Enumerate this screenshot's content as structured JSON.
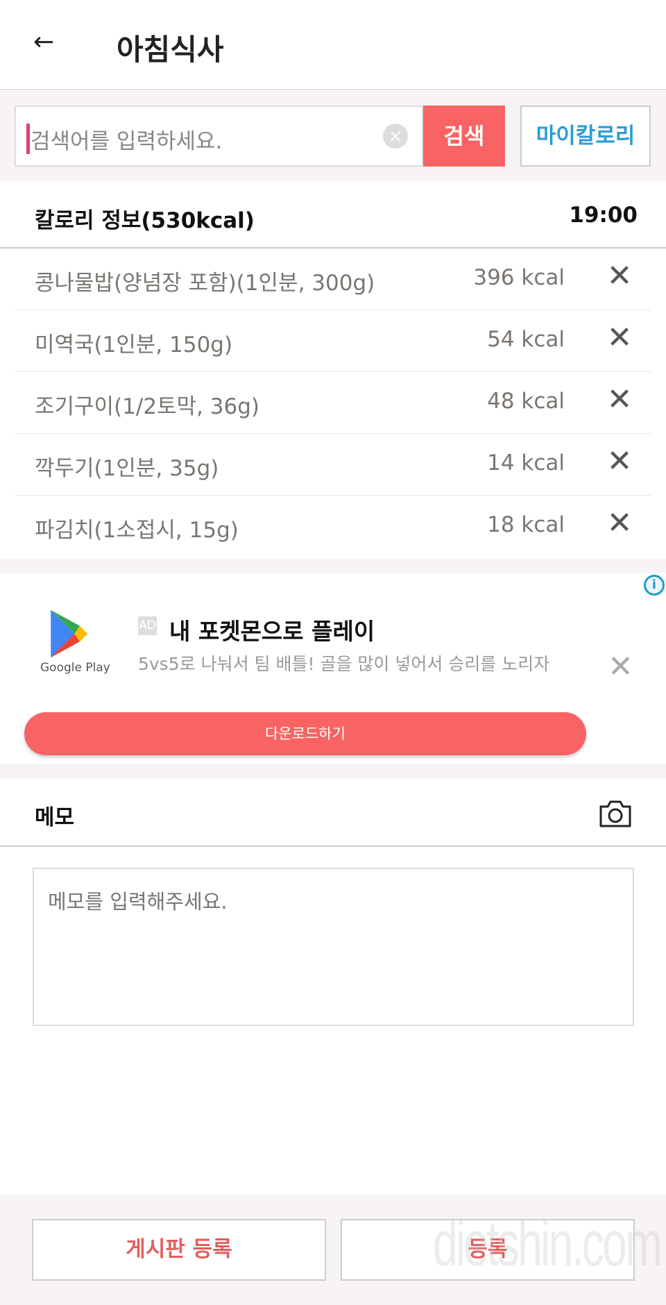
{
  "header": {
    "back_icon": "arrow-left-icon",
    "title": "아침식사"
  },
  "search": {
    "placeholder": "검색어를 입력하세요.",
    "clear_icon": "clear-circle-icon",
    "button": "검색",
    "my_calorie": "마이칼로리"
  },
  "calorie": {
    "title": "칼로리 정보(530kcal)",
    "time": "19:00",
    "items": [
      {
        "name": "콩나물밥(양념장 포함)(1인분, 300g)",
        "kcal": "396 kcal"
      },
      {
        "name": "미역국(1인분, 150g)",
        "kcal": "54 kcal"
      },
      {
        "name": "조기구이(1/2토막, 36g)",
        "kcal": "48 kcal"
      },
      {
        "name": "깍두기(1인분, 35g)",
        "kcal": "14 kcal"
      },
      {
        "name": "파김치(1소접시, 15g)",
        "kcal": "18 kcal"
      }
    ]
  },
  "ad": {
    "info": "i",
    "brand": "Google Play",
    "badge": "AD",
    "title": "내 포켓몬으로 플레이",
    "desc": "5vs5로 나눠서 팀 배틀! 골을 많이 넣어서 승리를 노리자",
    "download": "다운로드하기"
  },
  "memo": {
    "title": "메모",
    "camera_icon": "camera-icon",
    "placeholder": "메모를 입력해주세요."
  },
  "footer": {
    "board_register": "게시판 등록",
    "register": "등록",
    "watermark": "dietshin.com"
  },
  "colors": {
    "accent": "#f76463",
    "link": "#2a9bd6",
    "bg": "#f7f3f6"
  }
}
